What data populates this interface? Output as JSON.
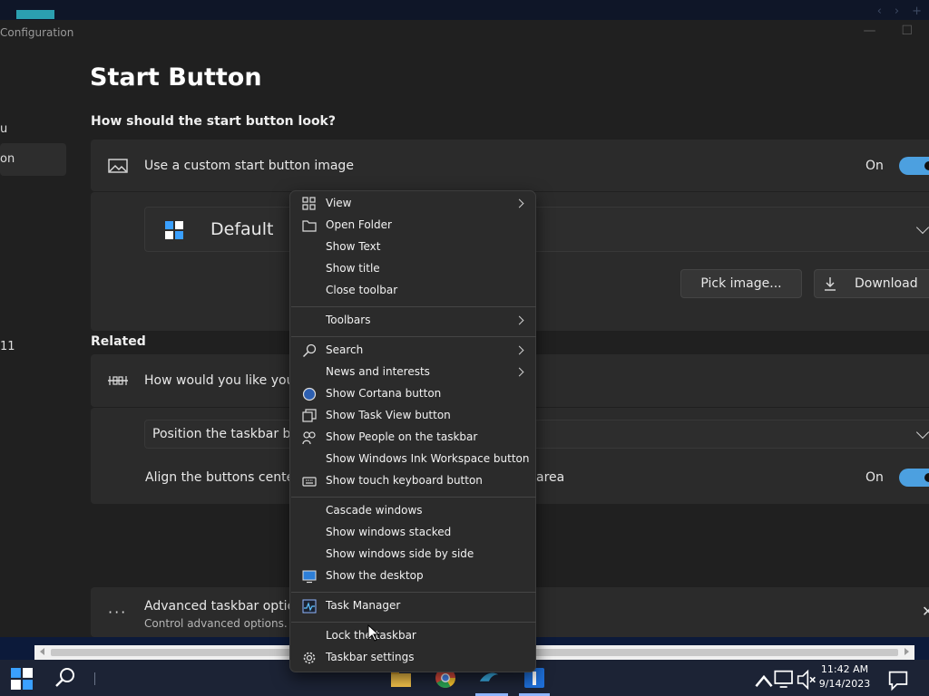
{
  "window": {
    "title": "Configuration"
  },
  "sidebar": {
    "items": [
      {
        "label": "u"
      },
      {
        "label": "on"
      },
      {
        "label": "11"
      }
    ]
  },
  "page": {
    "title": "Start Button",
    "section1_heading": "How should the start button look?",
    "custom_image_label": "Use a custom start button image",
    "custom_image_state": "On",
    "style_dropdown_value": "Default",
    "pick_image_label": "Pick image...",
    "download_label": "Download",
    "related_heading": "Related",
    "taskbar_question_label": "How would you like your t",
    "position_dropdown_value": "Position the taskbar butt",
    "align_label_part1": "Align the buttons center n",
    "align_label_part2": "area",
    "align_state": "On",
    "advanced_title": "Advanced taskbar options",
    "advanced_subtitle": "Control advanced options."
  },
  "context_menu": {
    "items": {
      "view": "View",
      "open_folder": "Open Folder",
      "show_text": "Show Text",
      "show_title": "Show title",
      "close_toolbar": "Close toolbar",
      "toolbars": "Toolbars",
      "search": "Search",
      "news": "News and interests",
      "cortana": "Show Cortana button",
      "task_view": "Show Task View button",
      "people": "Show People on the taskbar",
      "ink": "Show Windows Ink Workspace button",
      "touch_keyboard": "Show touch keyboard button",
      "cascade": "Cascade windows",
      "stacked": "Show windows stacked",
      "side_by_side": "Show windows side by side",
      "desktop": "Show the desktop",
      "task_manager": "Task Manager",
      "lock": "Lock the taskbar",
      "settings": "Taskbar settings"
    }
  },
  "taskbar": {
    "time": "11:42 AM",
    "date": "9/14/2023"
  },
  "colors": {
    "accent": "#4ca0e0",
    "window_bg": "#202020",
    "card_bg": "#2b2b2b",
    "menu_bg": "#2b2b2b",
    "taskbar_bg": "#1c2335"
  }
}
